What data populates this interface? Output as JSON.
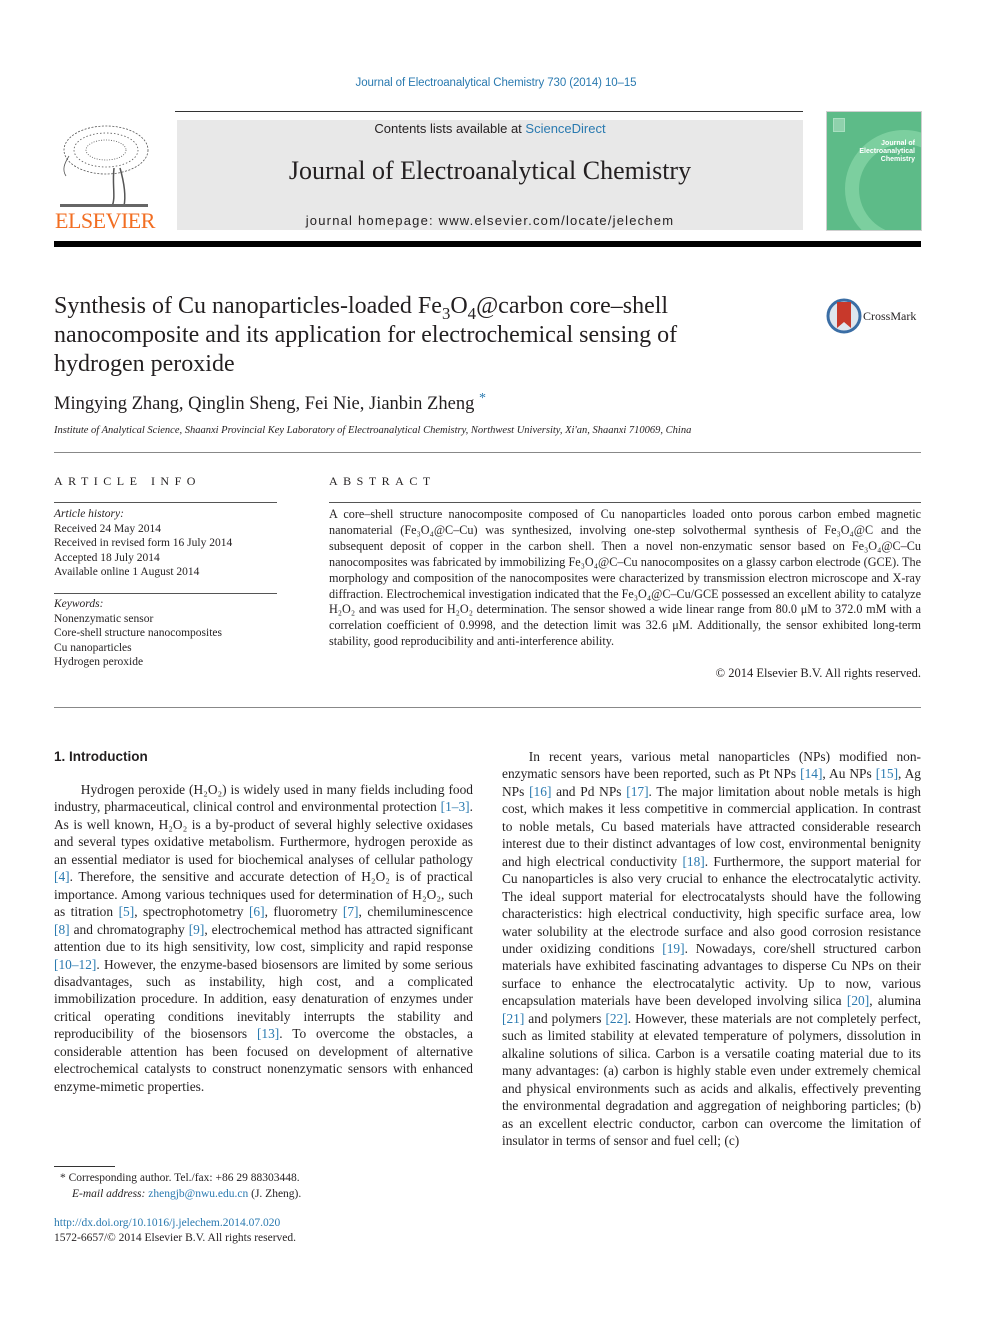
{
  "header": {
    "journal_ref": "Journal of Electroanalytical Chemistry 730 (2014) 10–15",
    "contents_prefix": "Contents lists available at ",
    "contents_link": "ScienceDirect",
    "journal_title": "Journal of Electroanalytical Chemistry",
    "homepage": "journal homepage: www.elsevier.com/locate/jelechem",
    "publisher_logo_text": "ELSEVIER",
    "cover_title": [
      "Journal of",
      "Electroanalytical",
      "Chemistry"
    ],
    "crossmark_label": "CrossMark",
    "colors": {
      "link": "#2a7ab0",
      "elsevier_orange": "#f26e22",
      "cover_green": "#5dbb88",
      "header_gray": "#e8e8e8"
    }
  },
  "article": {
    "title_parts": [
      "Synthesis of Cu nanoparticles-loaded Fe",
      "3",
      "O",
      "4",
      "@carbon core–shell nanocomposite and its application for electrochemical sensing of hydrogen peroxide"
    ],
    "authors": "Mingying Zhang, Qinglin Sheng, Fei Nie, Jianbin Zheng",
    "corresponding_mark": "*",
    "affiliation": "Institute of Analytical Science, Shaanxi Provincial Key Laboratory of Electroanalytical Chemistry, Northwest University, Xi'an, Shaanxi 710069, China"
  },
  "article_info": {
    "heading": "ARTICLE INFO",
    "history_label": "Article history:",
    "history": [
      "Received 24 May 2014",
      "Received in revised form 16 July 2014",
      "Accepted 18 July 2014",
      "Available online 1 August 2014"
    ],
    "keywords_label": "Keywords:",
    "keywords": [
      "Nonenzymatic sensor",
      "Core-shell structure nanocomposites",
      "Cu nanoparticles",
      "Hydrogen peroxide"
    ]
  },
  "abstract": {
    "heading": "ABSTRACT",
    "text": "A core–shell structure nanocomposite composed of Cu nanoparticles loaded onto porous carbon embed magnetic nanomaterial (Fe₃O₄@C–Cu) was synthesized, involving one-step solvothermal synthesis of Fe₃O₄@C and the subsequent deposit of copper in the carbon shell. Then a novel non-enzymatic sensor based on Fe₃O₄@C–Cu nanocomposites was fabricated by immobilizing Fe₃O₄@C–Cu nanocomposites on a glassy carbon electrode (GCE). The morphology and composition of the nanocomposites were characterized by transmission electron microscope and X-ray diffraction. Electrochemical investigation indicated that the Fe₃O₄@C–Cu/GCE possessed an excellent ability to catalyze H₂O₂ and was used for H₂O₂ determination. The sensor showed a wide linear range from 80.0 μM to 372.0 mM with a correlation coefficient of 0.9998, and the detection limit was 32.6 μM. Additionally, the sensor exhibited long-term stability, good reproducibility and anti-interference ability.",
    "copyright": "© 2014 Elsevier B.V. All rights reserved."
  },
  "introduction": {
    "heading": "1. Introduction",
    "left_column": [
      {
        "t": "Hydrogen peroxide (H₂O₂) is widely used in many fields including food industry, pharmaceutical, clinical control and environmental protection "
      },
      {
        "ref": "[1–3]"
      },
      {
        "t": ". As is well known, H₂O₂ is a by-product of several highly selective oxidases and several types oxidative metabolism. Furthermore, hydrogen peroxide as an essential mediator is used for biochemical analyses of cellular pathology "
      },
      {
        "ref": "[4]"
      },
      {
        "t": ". Therefore, the sensitive and accurate detection of H₂O₂ is of practical importance. Among various techniques used for determination of H₂O₂, such as titration "
      },
      {
        "ref": "[5]"
      },
      {
        "t": ", spectrophotometry "
      },
      {
        "ref": "[6]"
      },
      {
        "t": ", fluorometry "
      },
      {
        "ref": "[7]"
      },
      {
        "t": ", chemiluminescence "
      },
      {
        "ref": "[8]"
      },
      {
        "t": " and chromatography "
      },
      {
        "ref": "[9]"
      },
      {
        "t": ", electrochemical method has attracted significant attention due to its high sensitivity, low cost, simplicity and rapid response "
      },
      {
        "ref": "[10–12]"
      },
      {
        "t": ". However, the enzyme-based biosensors are limited by some serious disadvantages, such as instability, high cost, and a complicated immobilization procedure. In addition, easy denaturation of enzymes under critical operating conditions inevitably interrupts the stability and reproducibility of the biosensors "
      },
      {
        "ref": "[13]"
      },
      {
        "t": ". To overcome the obstacles, a considerable attention has been focused on development of alternative electrochemical catalysts to construct nonenzymatic sensors with enhanced enzyme-mimetic properties."
      }
    ],
    "right_column": [
      {
        "t": "In recent years, various metal nanoparticles (NPs) modified non-enzymatic sensors have been reported, such as Pt NPs "
      },
      {
        "ref": "[14]"
      },
      {
        "t": ", Au NPs "
      },
      {
        "ref": "[15]"
      },
      {
        "t": ", Ag NPs "
      },
      {
        "ref": "[16]"
      },
      {
        "t": " and Pd NPs "
      },
      {
        "ref": "[17]"
      },
      {
        "t": ". The major limitation about noble metals is high cost, which makes it less competitive in commercial application. In contrast to noble metals, Cu based materials have attracted considerable research interest due to their distinct advantages of low cost, environmental benignity and high electrical conductivity "
      },
      {
        "ref": "[18]"
      },
      {
        "t": ". Furthermore, the support material for Cu nanoparticles is also very crucial to enhance the electrocatalytic activity. The ideal support material for electrocatalysts should have the following characteristics: high electrical conductivity, high specific surface area, low water solubility at the electrode surface and also good corrosion resistance under oxidizing conditions "
      },
      {
        "ref": "[19]"
      },
      {
        "t": ". Nowadays, core/shell structured carbon materials have exhibited fascinating advantages to disperse Cu NPs on their surface to enhance the electrocatalytic activity. Up to now, various encapsulation materials have been developed involving silica "
      },
      {
        "ref": "[20]"
      },
      {
        "t": ", alumina "
      },
      {
        "ref": "[21]"
      },
      {
        "t": " and polymers "
      },
      {
        "ref": "[22]"
      },
      {
        "t": ". However, these materials are not completely perfect, such as limited stability at elevated temperature of polymers, dissolution in alkaline solutions of silica. Carbon is a versatile coating material due to its many advantages: (a) carbon is highly stable even under extremely chemical and physical environments such as acids and alkalis, effectively preventing the environmental degradation and aggregation of neighboring particles; (b) as an excellent electric conductor, carbon can overcome the limitation of insulator in terms of sensor and fuel cell; (c)"
      }
    ]
  },
  "footnote": {
    "corresponding": "* Corresponding author. Tel./fax: +86 29 88303448.",
    "email_label": "E-mail address: ",
    "email": "zhengjb@nwu.edu.cn",
    "email_suffix": " (J. Zheng).",
    "doi": "http://dx.doi.org/10.1016/j.jelechem.2014.07.020",
    "issn": "1572-6657/© 2014 Elsevier B.V. All rights reserved."
  }
}
